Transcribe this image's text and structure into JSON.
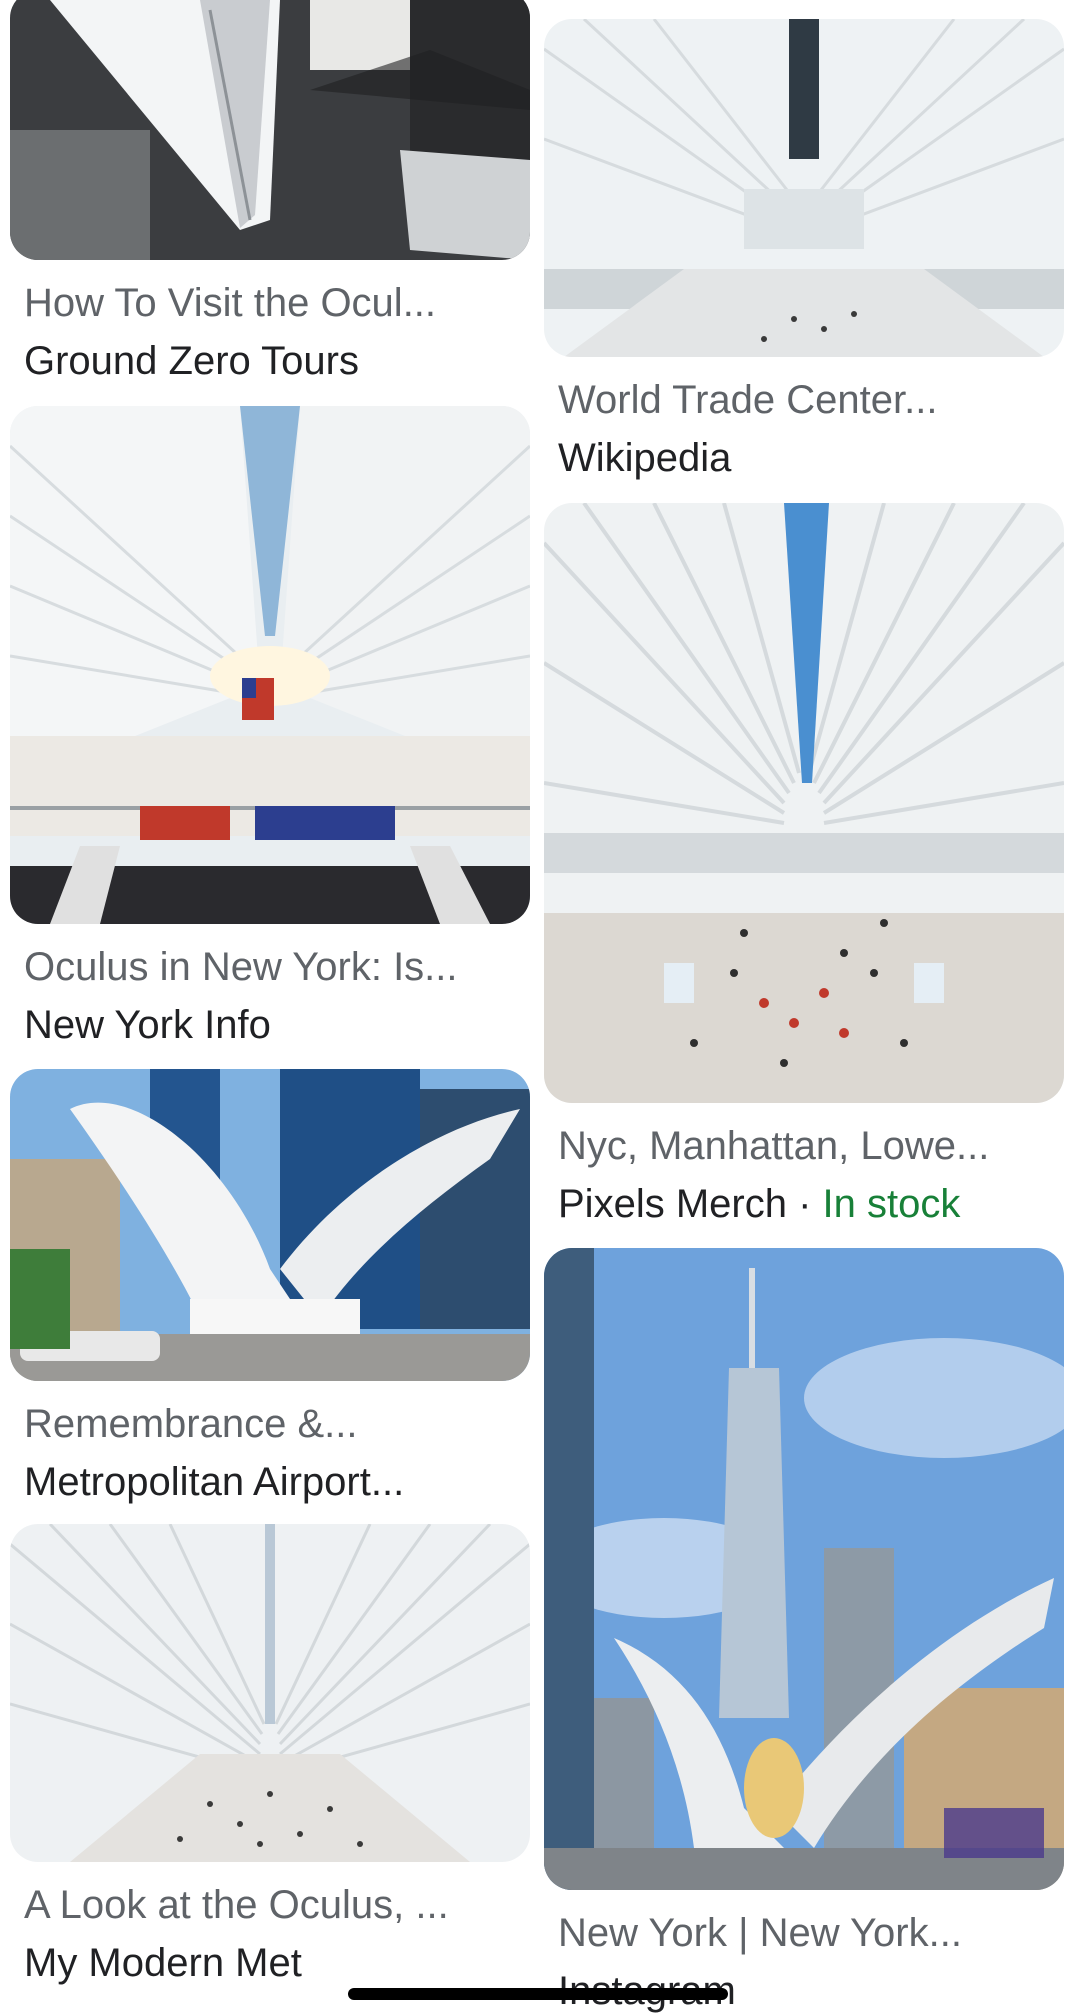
{
  "results": [
    {
      "title": "How To Visit the Ocul...",
      "source": "Ground Zero Tours",
      "image": "oculus-aerial-view"
    },
    {
      "title": "World Trade Center...",
      "source": "Wikipedia",
      "image": "oculus-interior-hall"
    },
    {
      "title": "Oculus in New York: Is...",
      "source": "New York Info",
      "image": "oculus-interior-flag"
    },
    {
      "title": "Nyc, Manhattan, Lowe...",
      "source": "Pixels Merch",
      "separator": "·",
      "stock": "In stock",
      "image": "oculus-interior-crowd"
    },
    {
      "title": "Remembrance &...",
      "source": "Metropolitan Airport...",
      "image": "oculus-exterior-street"
    },
    {
      "title": "New York | New York...",
      "source": "Instagram",
      "image": "oculus-one-world-trade"
    },
    {
      "title": "A Look at the Oculus, ...",
      "source": "My Modern Met",
      "image": "oculus-interior-ribs"
    }
  ],
  "colors": {
    "title_gray": "#5f6368",
    "source_dark": "#202124",
    "in_stock_green": "#188038"
  }
}
